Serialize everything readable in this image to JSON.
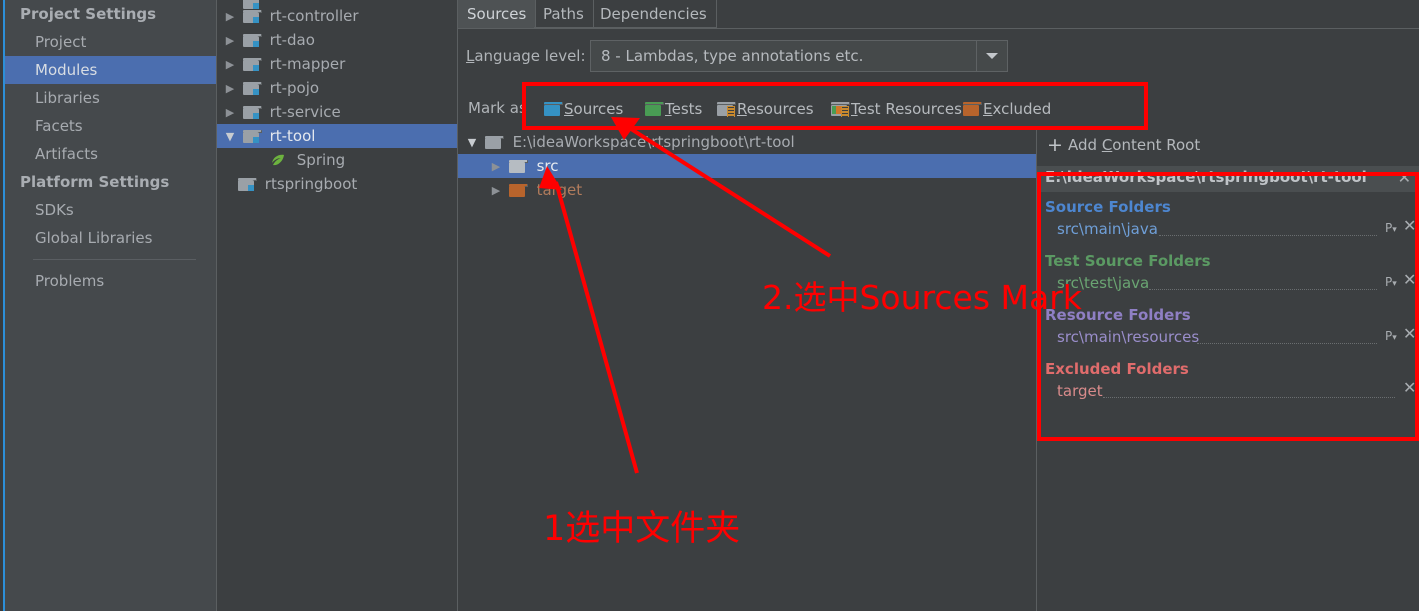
{
  "sidebar": {
    "groups": [
      {
        "title": "Project Settings",
        "items": [
          {
            "label": "Project",
            "selected": false
          },
          {
            "label": "Modules",
            "selected": true
          },
          {
            "label": "Libraries",
            "selected": false
          },
          {
            "label": "Facets",
            "selected": false
          },
          {
            "label": "Artifacts",
            "selected": false
          }
        ]
      },
      {
        "title": "Platform Settings",
        "items": [
          {
            "label": "SDKs",
            "selected": false
          },
          {
            "label": "Global Libraries",
            "selected": false
          }
        ]
      }
    ],
    "problems_label": "Problems"
  },
  "module_tree": {
    "rows": [
      {
        "label": "rt-controller",
        "icon": "module-folder-icon",
        "expander": "collapsed",
        "indent": 0,
        "state": "normal"
      },
      {
        "label": "rt-dao",
        "icon": "module-folder-icon",
        "expander": "collapsed",
        "indent": 0,
        "state": "normal"
      },
      {
        "label": "rt-mapper",
        "icon": "module-folder-icon",
        "expander": "collapsed",
        "indent": 0,
        "state": "normal"
      },
      {
        "label": "rt-pojo",
        "icon": "module-folder-icon",
        "expander": "collapsed",
        "indent": 0,
        "state": "normal"
      },
      {
        "label": "rt-service",
        "icon": "module-folder-icon",
        "expander": "collapsed",
        "indent": 0,
        "state": "normal"
      },
      {
        "label": "rt-tool",
        "icon": "module-folder-icon",
        "expander": "expanded",
        "indent": 0,
        "state": "selected"
      },
      {
        "label": "Spring",
        "icon": "spring-leaf-icon",
        "expander": "none",
        "indent": 1,
        "state": "normal"
      },
      {
        "label": "rtspringboot",
        "icon": "module-folder-icon",
        "expander": "none",
        "indent": 0,
        "state": "normal"
      }
    ]
  },
  "tabs": [
    {
      "label": "Sources",
      "active": true
    },
    {
      "label": "Paths",
      "active": false
    },
    {
      "label": "Dependencies",
      "active": false
    }
  ],
  "language_level": {
    "label_prefix": "L",
    "label_rest": "anguage level:",
    "value": "8 - Lambdas, type annotations etc.",
    "dropdown_icon": "chevron-down-icon"
  },
  "mark_as": {
    "label": "Mark as",
    "options": [
      {
        "mnemonic": "S",
        "rest": "ources",
        "icon": "sources-folder-icon",
        "color": "#3592c4"
      },
      {
        "mnemonic": "T",
        "rest": "ests",
        "icon": "tests-folder-icon",
        "color": "#499c54"
      },
      {
        "mnemonic": "R",
        "rest": "esources",
        "icon": "resources-folder-icon",
        "color": "#9aa0a6"
      },
      {
        "mnemonic": "T",
        "rest": "est Resources",
        "icon": "test-resources-folder-icon",
        "color": "#9aa0a6"
      },
      {
        "mnemonic": "E",
        "rest": "xcluded",
        "icon": "excluded-folder-icon",
        "color": "#b8642c"
      }
    ]
  },
  "content_root_tree": {
    "rows": [
      {
        "label": "E:\\ideaWorkspace\\rtspringboot\\rt-tool",
        "expander": "expanded",
        "indent": 0,
        "color": "#9aa0a6",
        "selected": false
      },
      {
        "label": "src",
        "expander": "collapsed",
        "indent": 1,
        "color": "#b6bcc2",
        "selected": true
      },
      {
        "label": "target",
        "expander": "collapsed",
        "indent": 1,
        "color": "#b8642c",
        "selected": false
      }
    ]
  },
  "detail_panel": {
    "add_content_root": {
      "plus": "+",
      "mnemonic_pre": "Add ",
      "mnemonic": "C",
      "mnemonic_post": "ontent Root"
    },
    "content_root_path": "E:\\ideaWorkspace\\rtspringboot\\rt-tool",
    "close_icon": "close-icon",
    "groups": [
      {
        "title": "Source Folders",
        "color": "#4d86d0",
        "entries": [
          {
            "path": "src\\main\\java",
            "color": "#6f9fd8",
            "has_props": true
          }
        ]
      },
      {
        "title": "Test Source Folders",
        "color": "#5b9a63",
        "entries": [
          {
            "path": "src\\test\\java",
            "color": "#6aa572",
            "has_props": true
          }
        ]
      },
      {
        "title": "Resource Folders",
        "color": "#8f7fc4",
        "entries": [
          {
            "path": "src\\main\\resources",
            "color": "#9a8ecb",
            "has_props": true
          }
        ]
      },
      {
        "title": "Excluded Folders",
        "color": "#e06c6c",
        "entries": [
          {
            "path": "target",
            "color": "#d98b8b",
            "has_props": false
          }
        ]
      }
    ],
    "prop_icon": "properties-icon",
    "remove_icon": "remove-x-icon"
  },
  "annotations": {
    "accent_color": "#ff0000",
    "note_1": "1选中文件夹",
    "note_2": "2.选中Sources Mark"
  }
}
